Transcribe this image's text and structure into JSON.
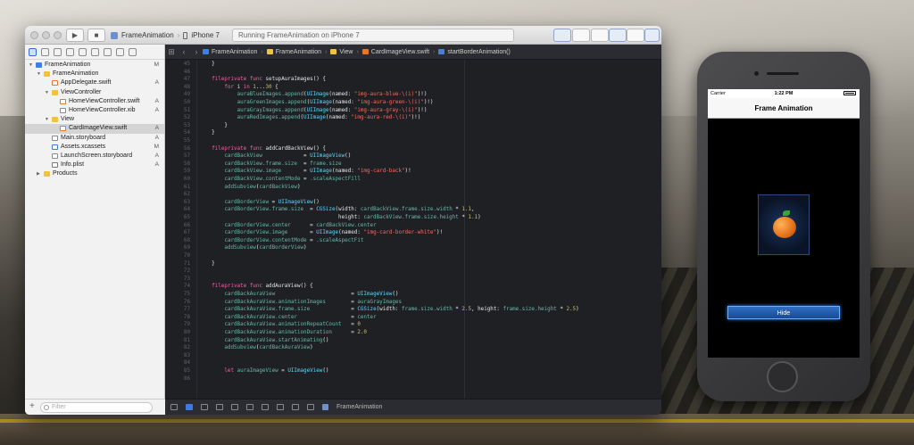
{
  "window": {
    "scheme_project": "FrameAnimation",
    "scheme_device": "iPhone 7",
    "status_text": "Running FrameAnimation on iPhone 7"
  },
  "navigator": {
    "filter_placeholder": "Filter",
    "tree": [
      {
        "name": "FrameAnimation",
        "icon": "project-icon",
        "flag": "M",
        "level": 0,
        "expanded": true
      },
      {
        "name": "FrameAnimation",
        "icon": "folder-icon",
        "flag": "",
        "level": 1,
        "expanded": true
      },
      {
        "name": "AppDelegate.swift",
        "icon": "swift-file-icon",
        "flag": "A",
        "level": 2
      },
      {
        "name": "ViewController",
        "icon": "folder-icon",
        "flag": "",
        "level": 2,
        "expanded": true
      },
      {
        "name": "HomeViewController.swift",
        "icon": "swift-file-icon",
        "flag": "A",
        "level": 3
      },
      {
        "name": "HomeViewController.xib",
        "icon": "xib-file-icon",
        "flag": "A",
        "level": 3
      },
      {
        "name": "View",
        "icon": "folder-icon",
        "flag": "",
        "level": 2,
        "expanded": true
      },
      {
        "name": "CardImageView.swift",
        "icon": "swift-file-icon",
        "flag": "A",
        "level": 3,
        "selected": true
      },
      {
        "name": "Main.storyboard",
        "icon": "storyboard-icon",
        "flag": "A",
        "level": 2
      },
      {
        "name": "Assets.xcassets",
        "icon": "assets-icon",
        "flag": "M",
        "level": 2
      },
      {
        "name": "LaunchScreen.storyboard",
        "icon": "storyboard-icon",
        "flag": "A",
        "level": 2
      },
      {
        "name": "Info.plist",
        "icon": "plist-icon",
        "flag": "A",
        "level": 2
      },
      {
        "name": "Products",
        "icon": "folder-icon",
        "flag": "",
        "level": 1,
        "expanded": false
      }
    ]
  },
  "jumpbar": {
    "crumbs": [
      "FrameAnimation",
      "FrameAnimation",
      "View",
      "CardImageView.swift",
      "startBorderAnimation()"
    ]
  },
  "editor": {
    "lines": [
      {
        "n": "45",
        "c": "    }"
      },
      {
        "n": "46",
        "c": ""
      },
      {
        "n": "47",
        "c": "    fileprivate func setupAuraImages() {"
      },
      {
        "n": "48",
        "c": "        for i in 1...30 {"
      },
      {
        "n": "49",
        "c": "            auraBlueImages.append(UIImage(named: \"img-aura-blue-\\(i)\")!)"
      },
      {
        "n": "50",
        "c": "            auraGreenImages.append(UIImage(named: \"img-aura-green-\\(i)\")!)"
      },
      {
        "n": "51",
        "c": "            auraGrayImages.append(UIImage(named: \"img-aura-gray-\\(i)\")!)"
      },
      {
        "n": "52",
        "c": "            auraRedImages.append(UIImage(named: \"img-aura-red-\\(i)\")!)"
      },
      {
        "n": "53",
        "c": "        }"
      },
      {
        "n": "54",
        "c": "    }"
      },
      {
        "n": "55",
        "c": ""
      },
      {
        "n": "56",
        "c": "    fileprivate func addCardBackView() {"
      },
      {
        "n": "57",
        "c": "        cardBackView             = UIImageView()"
      },
      {
        "n": "58",
        "c": "        cardBackView.frame.size  = frame.size"
      },
      {
        "n": "59",
        "c": "        cardBackView.image       = UIImage(named: \"img-card-back\")!"
      },
      {
        "n": "60",
        "c": "        cardBackView.contentMode = .scaleAspectFill"
      },
      {
        "n": "61",
        "c": "        addSubview(cardBackView)"
      },
      {
        "n": "62",
        "c": ""
      },
      {
        "n": "63",
        "c": "        cardBorderView = UIImageView()"
      },
      {
        "n": "64",
        "c": "        cardBorderView.frame.size  = CGSize(width: cardBackView.frame.size.width * 1.1,"
      },
      {
        "n": "65",
        "c": "                                            height: cardBackView.frame.size.height * 1.1)"
      },
      {
        "n": "66",
        "c": "        cardBorderView.center      = cardBackView.center"
      },
      {
        "n": "67",
        "c": "        cardBorderView.image       = UIImage(named: \"img-card-border-white\")!"
      },
      {
        "n": "68",
        "c": "        cardBorderView.contentMode = .scaleAspectFit"
      },
      {
        "n": "69",
        "c": "        addSubview(cardBorderView)"
      },
      {
        "n": "70",
        "c": ""
      },
      {
        "n": "71",
        "c": "    }"
      },
      {
        "n": "72",
        "c": ""
      },
      {
        "n": "73",
        "c": ""
      },
      {
        "n": "74",
        "c": "    fileprivate func addAuraView() {"
      },
      {
        "n": "75",
        "c": "        cardBackAuraView                        = UIImageView()"
      },
      {
        "n": "76",
        "c": "        cardBackAuraView.animationImages        = auraGrayImages"
      },
      {
        "n": "77",
        "c": "        cardBackAuraView.frame.size             = CGSize(width: frame.size.width * 2.5, height: frame.size.height * 2.5)"
      },
      {
        "n": "78",
        "c": "        cardBackAuraView.center                 = center"
      },
      {
        "n": "79",
        "c": "        cardBackAuraView.animationRepeatCount   = 0"
      },
      {
        "n": "80",
        "c": "        cardBackAuraView.animationDuration      = 2.0"
      },
      {
        "n": "81",
        "c": "        cardBackAuraView.startAnimating()"
      },
      {
        "n": "82",
        "c": "        addSubview(cardBackAuraView)"
      },
      {
        "n": "83",
        "c": ""
      },
      {
        "n": "84",
        "c": ""
      },
      {
        "n": "85",
        "c": "        let auraImageView = UIImageView()"
      },
      {
        "n": "86",
        "c": ""
      }
    ]
  },
  "debugbar": {
    "target": "FrameAnimation"
  },
  "simulator": {
    "carrier": "Carrier",
    "time": "1:22 PM",
    "nav_title": "Frame Animation",
    "hide_label": "Hide"
  },
  "colors": {
    "keyword": "#fc5fa3",
    "type": "#5dd8ff",
    "string": "#fc6a5d",
    "number": "#d0bf69",
    "property": "#67b7a4",
    "function": "#a167e6",
    "plain": "#e6e6e6",
    "accent": "#2f6ed6"
  }
}
